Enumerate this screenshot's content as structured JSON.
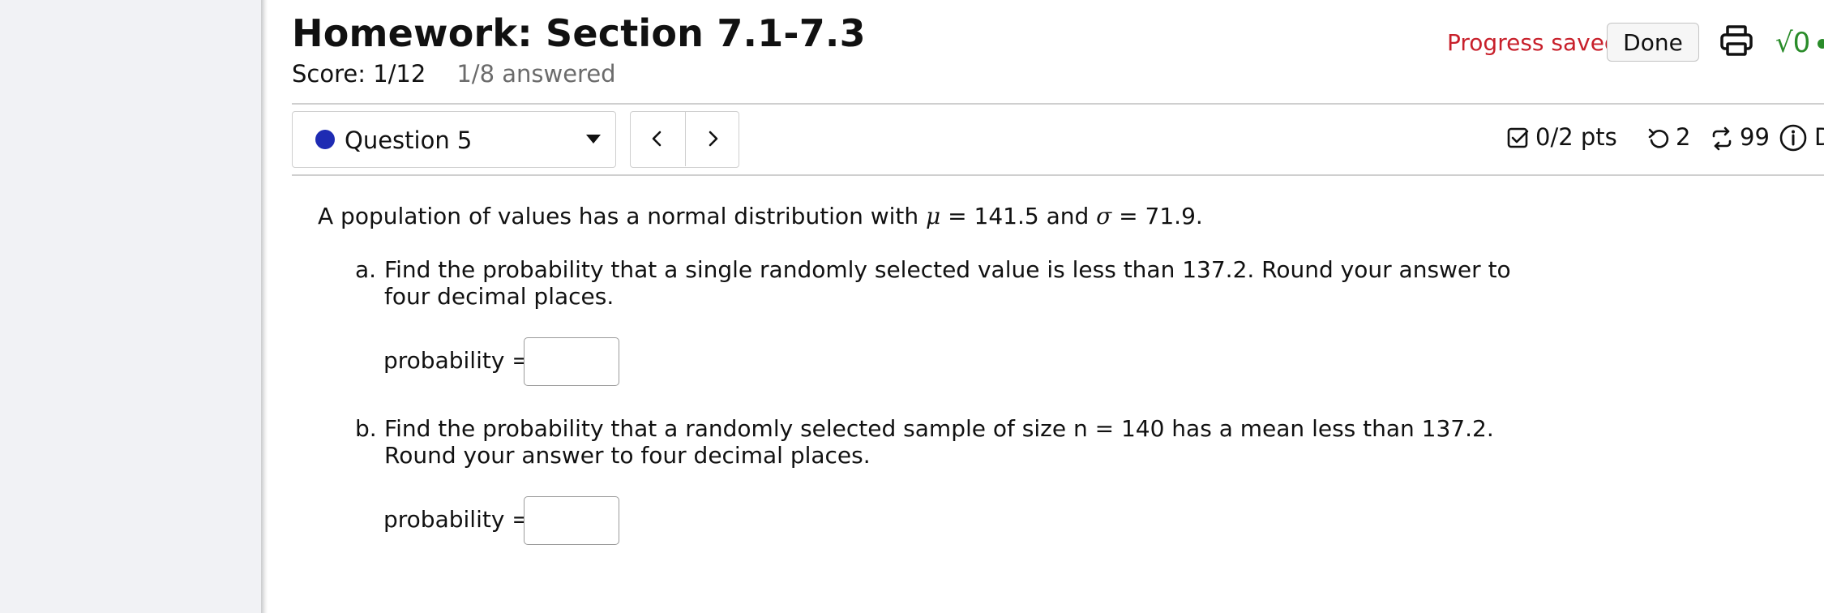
{
  "header": {
    "title": "Homework: Section 7.1-7.3",
    "score": "Score: 1/12",
    "answered": "1/8 answered",
    "progress_status": "Progress saved",
    "done_label": "Done",
    "sqrt_label": "√0"
  },
  "question_nav": {
    "selected_question": "Question 5",
    "prev_label": "<",
    "next_label": ">"
  },
  "meta": {
    "points": "0/2 pts",
    "retries": "2",
    "attempts": "99",
    "details_label": "Details"
  },
  "question": {
    "intro_prefix": "A population of values has a normal distribution with ",
    "mu_symbol": "μ",
    "mu_value": " = 141.5 and ",
    "sigma_symbol": "σ",
    "sigma_value": " = 71.9.",
    "part_a": {
      "letter": "a.",
      "line1": "Find the probability that a single randomly selected value is less than 137.2. Round your answer to",
      "line2": "four decimal places.",
      "input_label": "probability =",
      "input_value": ""
    },
    "part_b": {
      "letter": "b.",
      "line1": "Find the probability that a randomly selected sample of size n = 140 has a mean less than 137.2.",
      "line2": "Round your answer to four decimal places.",
      "input_label": "probability =",
      "input_value": ""
    }
  },
  "colors": {
    "progress_saved": "#c8202b",
    "question_dot": "#1e2bb3",
    "sqrt_green": "#2a8c2a"
  }
}
